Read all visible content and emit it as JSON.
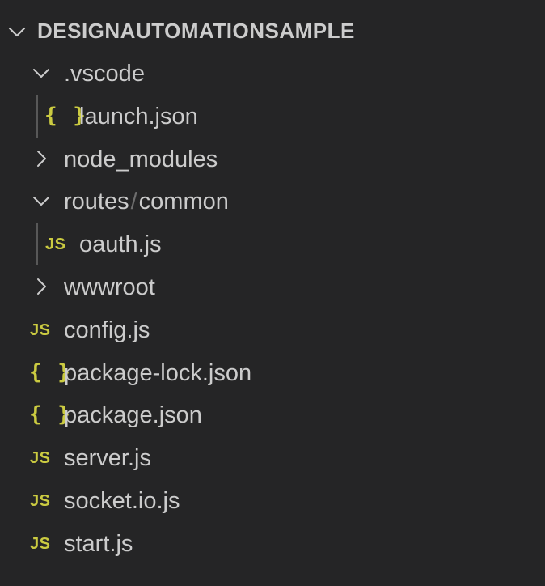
{
  "explorer": {
    "root_title": "DESIGNAUTOMATIONSAMPLE",
    "colors": {
      "background": "#252526",
      "text": "#cccccc",
      "icon_yellow": "#cbcb41",
      "indent_guide": "#585858",
      "separator": "#6e6e6e"
    },
    "items": [
      {
        "label": ".vscode",
        "type": "folder",
        "expanded": true,
        "icon": "chevron-down-icon"
      },
      {
        "label": "launch.json",
        "type": "file",
        "icon": "json-file-icon",
        "icon_text": "{ }"
      },
      {
        "label": "node_modules",
        "type": "folder",
        "expanded": false,
        "icon": "chevron-right-icon"
      },
      {
        "label": "routes",
        "label_suffix": "common",
        "separator": "/",
        "type": "folder",
        "expanded": true,
        "icon": "chevron-down-icon"
      },
      {
        "label": "oauth.js",
        "type": "file",
        "icon": "js-file-icon",
        "icon_text": "JS"
      },
      {
        "label": "wwwroot",
        "type": "folder",
        "expanded": false,
        "icon": "chevron-right-icon"
      },
      {
        "label": "config.js",
        "type": "file",
        "icon": "js-file-icon",
        "icon_text": "JS"
      },
      {
        "label": "package-lock.json",
        "type": "file",
        "icon": "json-file-icon",
        "icon_text": "{ }"
      },
      {
        "label": "package.json",
        "type": "file",
        "icon": "json-file-icon",
        "icon_text": "{ }"
      },
      {
        "label": "server.js",
        "type": "file",
        "icon": "js-file-icon",
        "icon_text": "JS"
      },
      {
        "label": "socket.io.js",
        "type": "file",
        "icon": "js-file-icon",
        "icon_text": "JS"
      },
      {
        "label": "start.js",
        "type": "file",
        "icon": "js-file-icon",
        "icon_text": "JS"
      }
    ]
  }
}
